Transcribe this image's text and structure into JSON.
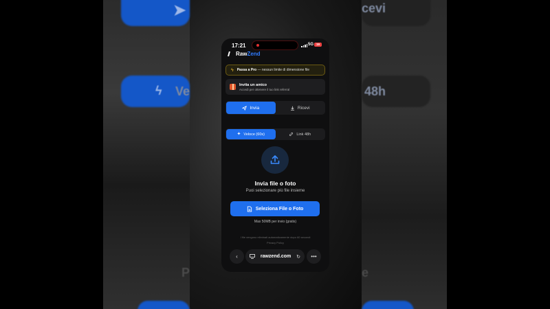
{
  "background": {
    "left_text": "Ve",
    "right_text_top": "cevi",
    "right_text_mid": "48h",
    "left_text_bottom": "P",
    "right_text_bottom": "e"
  },
  "status_bar": {
    "time": "17:21",
    "network": "5G",
    "battery": "19"
  },
  "brand": {
    "part_a": "Raw",
    "part_b": "Zend"
  },
  "pro_banner": {
    "title": "Passa a Pro",
    "text": " — nessun limite di dimensione file"
  },
  "invite": {
    "title": "Invita un amico",
    "subtitle": "Accedi per ottenere il tuo link referral"
  },
  "main_tabs": [
    {
      "label": "Invia",
      "icon": "send-icon",
      "active": true
    },
    {
      "label": "Ricevi",
      "icon": "download-icon",
      "active": false
    }
  ],
  "mode_tabs": [
    {
      "label": "Veloce (60s)",
      "icon": "sparkle-icon",
      "active": true
    },
    {
      "label": "Link 48h",
      "icon": "link-icon",
      "active": false
    }
  ],
  "upload": {
    "title": "Invia file o foto",
    "subtitle": "Puoi selezionare più file insieme",
    "button_label": "Seleziona File o Foto",
    "limit": "Max 50MB per invio (gratis)"
  },
  "footer": {
    "note": "I file vengono eliminati automaticamente dopo 60 secondi",
    "privacy": "Privacy Policy"
  },
  "browser": {
    "url": "rawzend.com"
  },
  "colors": {
    "accent": "#1f6fee",
    "pro_border": "#6b5a12",
    "recording_dot": "#e23030"
  }
}
